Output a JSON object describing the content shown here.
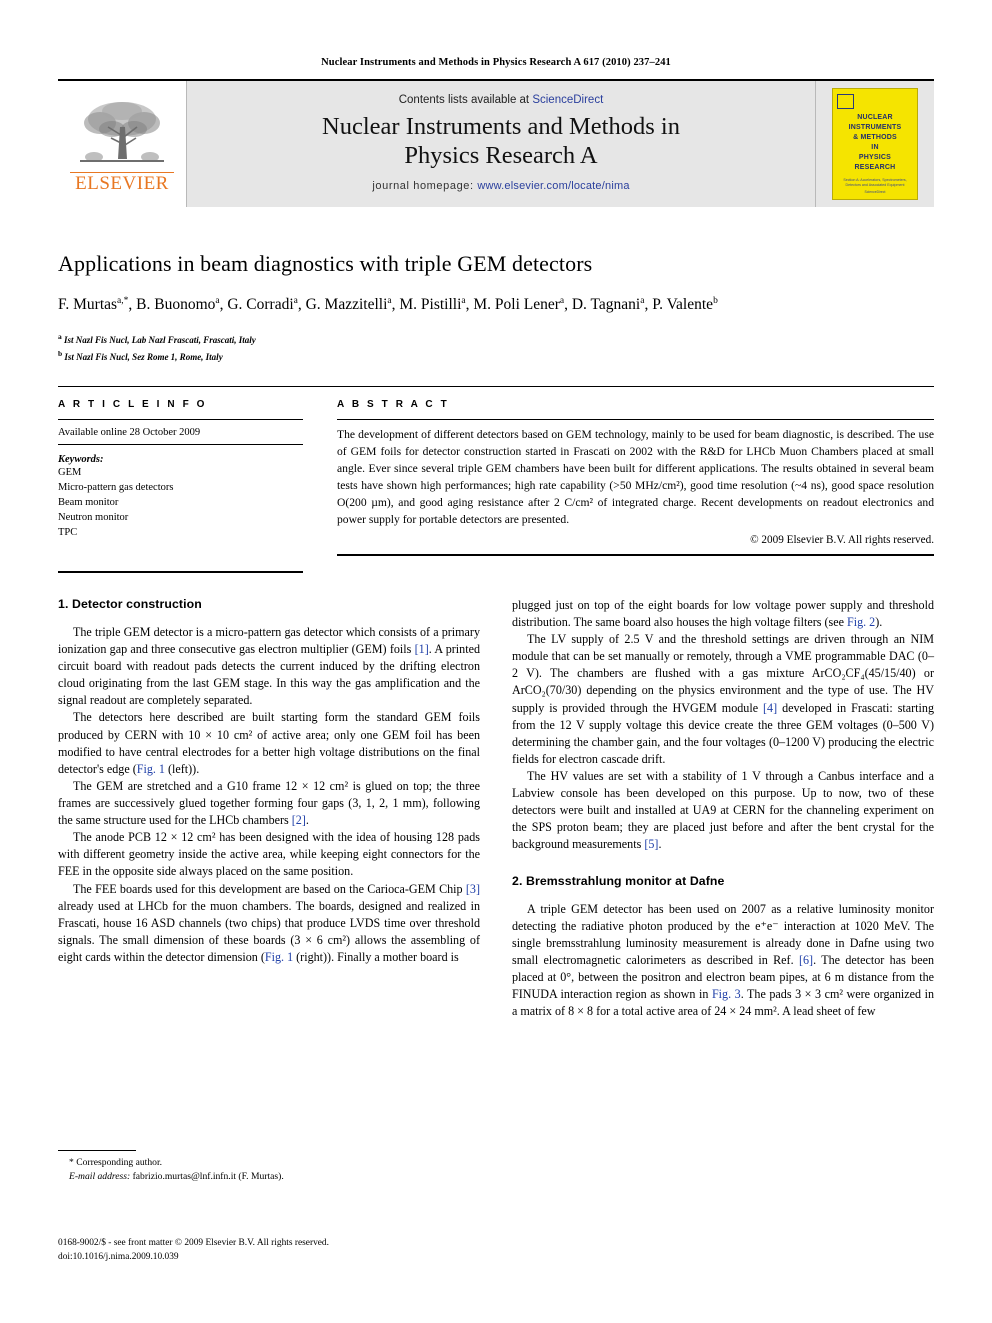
{
  "running_head": "Nuclear Instruments and Methods in Physics Research A 617 (2010) 237–241",
  "masthead": {
    "contents_prefix": "Contents lists available at ",
    "contents_link": "ScienceDirect",
    "journal_title_line1": "Nuclear Instruments and Methods in",
    "journal_title_line2": "Physics Research A",
    "homepage_prefix": "journal homepage: ",
    "homepage_url": "www.elsevier.com/locate/nima",
    "publisher": "ELSEVIER",
    "cover": {
      "badge_text": "NUCLEAR INSTRUMENTS",
      "title_lines": [
        "NUCLEAR",
        "INSTRUMENTS",
        "& METHODS",
        "IN",
        "PHYSICS",
        "RESEARCH"
      ],
      "subtitle_lines": [
        "Section A: Accelerators, Spectrometers,",
        "Detectors and Associated Equipment"
      ],
      "footer": "ScienceDirect"
    }
  },
  "article": {
    "title": "Applications in beam diagnostics with triple GEM detectors",
    "authors_line1_parts": [
      {
        "name": "F. Murtas",
        "sup": "a,*"
      },
      {
        "name": "B. Buonomo",
        "sup": "a"
      },
      {
        "name": "G. Corradi",
        "sup": "a"
      },
      {
        "name": "G. Mazzitelli",
        "sup": "a"
      },
      {
        "name": "M. Pistilli",
        "sup": "a"
      },
      {
        "name": "M. Poli Lener",
        "sup": "a"
      },
      {
        "name": "D. Tagnani",
        "sup": "a"
      }
    ],
    "authors_line2": {
      "name": "P. Valente",
      "sup": "b"
    },
    "affiliations": [
      {
        "mark": "a",
        "text": "Ist Nazl Fis Nucl, Lab Nazl Frascati, Frascati, Italy"
      },
      {
        "mark": "b",
        "text": "Ist Nazl Fis Nucl, Sez Rome 1, Rome, Italy"
      }
    ]
  },
  "info": {
    "heading": "A R T I C L E   I N F O",
    "available_online": "Available online 28 October 2009",
    "keywords_label": "Keywords:",
    "keywords": [
      "GEM",
      "Micro-pattern gas detectors",
      "Beam monitor",
      "Neutron monitor",
      "TPC"
    ]
  },
  "abstract": {
    "heading": "A B S T R A C T",
    "text": "The development of different detectors based on GEM technology, mainly to be used for beam diagnostic, is described. The use of GEM foils for detector construction started in Frascati on 2002 with the R&D for LHCb Muon Chambers placed at small angle. Ever since several triple GEM chambers have been built for different applications. The results obtained in several beam tests have shown high performances; high rate capability (>50 MHz/cm²), good time resolution (~4 ns), good space resolution O(200 µm), and good aging resistance after 2 C/cm² of integrated charge. Recent developments on readout electronics and power supply for portable detectors are presented.",
    "copyright": "© 2009 Elsevier B.V. All rights reserved."
  },
  "sections": {
    "s1_heading": "1.  Detector construction",
    "s1_p1": "The triple GEM detector is a micro-pattern gas detector which consists of a primary ionization gap and three consecutive gas electron multiplier (GEM) foils [1]. A printed circuit board with readout pads detects the current induced by the drifting electron cloud originating from the last GEM stage. In this way the gas amplification and the signal readout are completely separated.",
    "s1_p2": "The detectors here described are built starting form the standard GEM foils produced by CERN with 10 × 10 cm² of active area; only one GEM foil has been modified to have central electrodes for a better high voltage distributions on the final detector's edge (Fig. 1 (left)).",
    "s1_p3": "The GEM are stretched and a G10 frame 12 × 12 cm² is glued on top; the three frames are successively glued together forming four gaps (3, 1, 2, 1 mm), following the same structure used for the LHCb chambers [2].",
    "s1_p4": "The anode PCB 12 × 12 cm² has been designed with the idea of housing 128 pads with different geometry inside the active area, while keeping eight connectors for the FEE in the opposite side always placed on the same position.",
    "s1_p5": "The FEE boards used for this development are based on the Carioca-GEM Chip [3] already used at LHCb for the muon chambers. The boards, designed and realized in Frascati, house 16 ASD channels (two chips) that produce LVDS time over threshold signals. The small dimension of these boards (3 × 6 cm²) allows the assembling of eight cards within the detector dimension (Fig. 1 (right)). Finally a mother board is",
    "s1_p6": "plugged just on top of the eight boards for low voltage power supply and threshold distribution. The same board also houses the high voltage filters (see Fig. 2).",
    "s1_p7": "The LV supply of 2.5 V and the threshold settings are driven through an NIM module that can be set manually or remotely, through a VME programmable DAC (0–2 V). The chambers are flushed with a gas mixture ArCO₂CF₄(45/15/40) or ArCO₂(70/30) depending on the physics environment and the type of use. The HV supply is provided through the HVGEM module [4] developed in Frascati: starting from the 12 V supply voltage this device create the three GEM voltages (0–500 V) determining the chamber gain, and the four voltages (0–1200 V) producing the electric fields for electron cascade drift.",
    "s1_p8": "The HV values are set with a stability of 1 V through a Canbus interface and a Labview console has been developed on this purpose. Up to now, two of these detectors were built and installed at UA9 at CERN for the channeling experiment on the SPS proton beam; they are placed just before and after the bent crystal for the background measurements [5].",
    "s2_heading": "2.  Bremsstrahlung monitor at Dafne",
    "s2_p1": "A triple GEM detector has been used on 2007 as a relative luminosity monitor detecting the radiative photon produced by the e⁺e⁻ interaction at 1020 MeV. The single bremsstrahlung luminosity measurement is already done in Dafne using two small electromagnetic calorimeters as described in Ref. [6]. The detector has been placed at 0°, between the positron and electron beam pipes, at 6 m distance from the FINUDA interaction region as shown in Fig. 3. The pads 3 × 3 cm² were organized in a matrix of 8 × 8 for a total active area of 24 × 24 mm². A lead sheet of few"
  },
  "footnotes": {
    "corresponding": "Corresponding author.",
    "email_label": "E-mail address:",
    "email": "fabrizio.murtas@lnf.infn.it (F. Murtas)."
  },
  "footer": {
    "issn_line": "0168-9002/$ - see front matter © 2009 Elsevier B.V. All rights reserved.",
    "doi_line": "doi:10.1016/j.nima.2009.10.039"
  },
  "colors": {
    "link": "#1f3fa8",
    "elsevier_orange": "#e87722",
    "cover_yellow": "#f5e400",
    "masthead_gray": "#e6e6e6"
  }
}
